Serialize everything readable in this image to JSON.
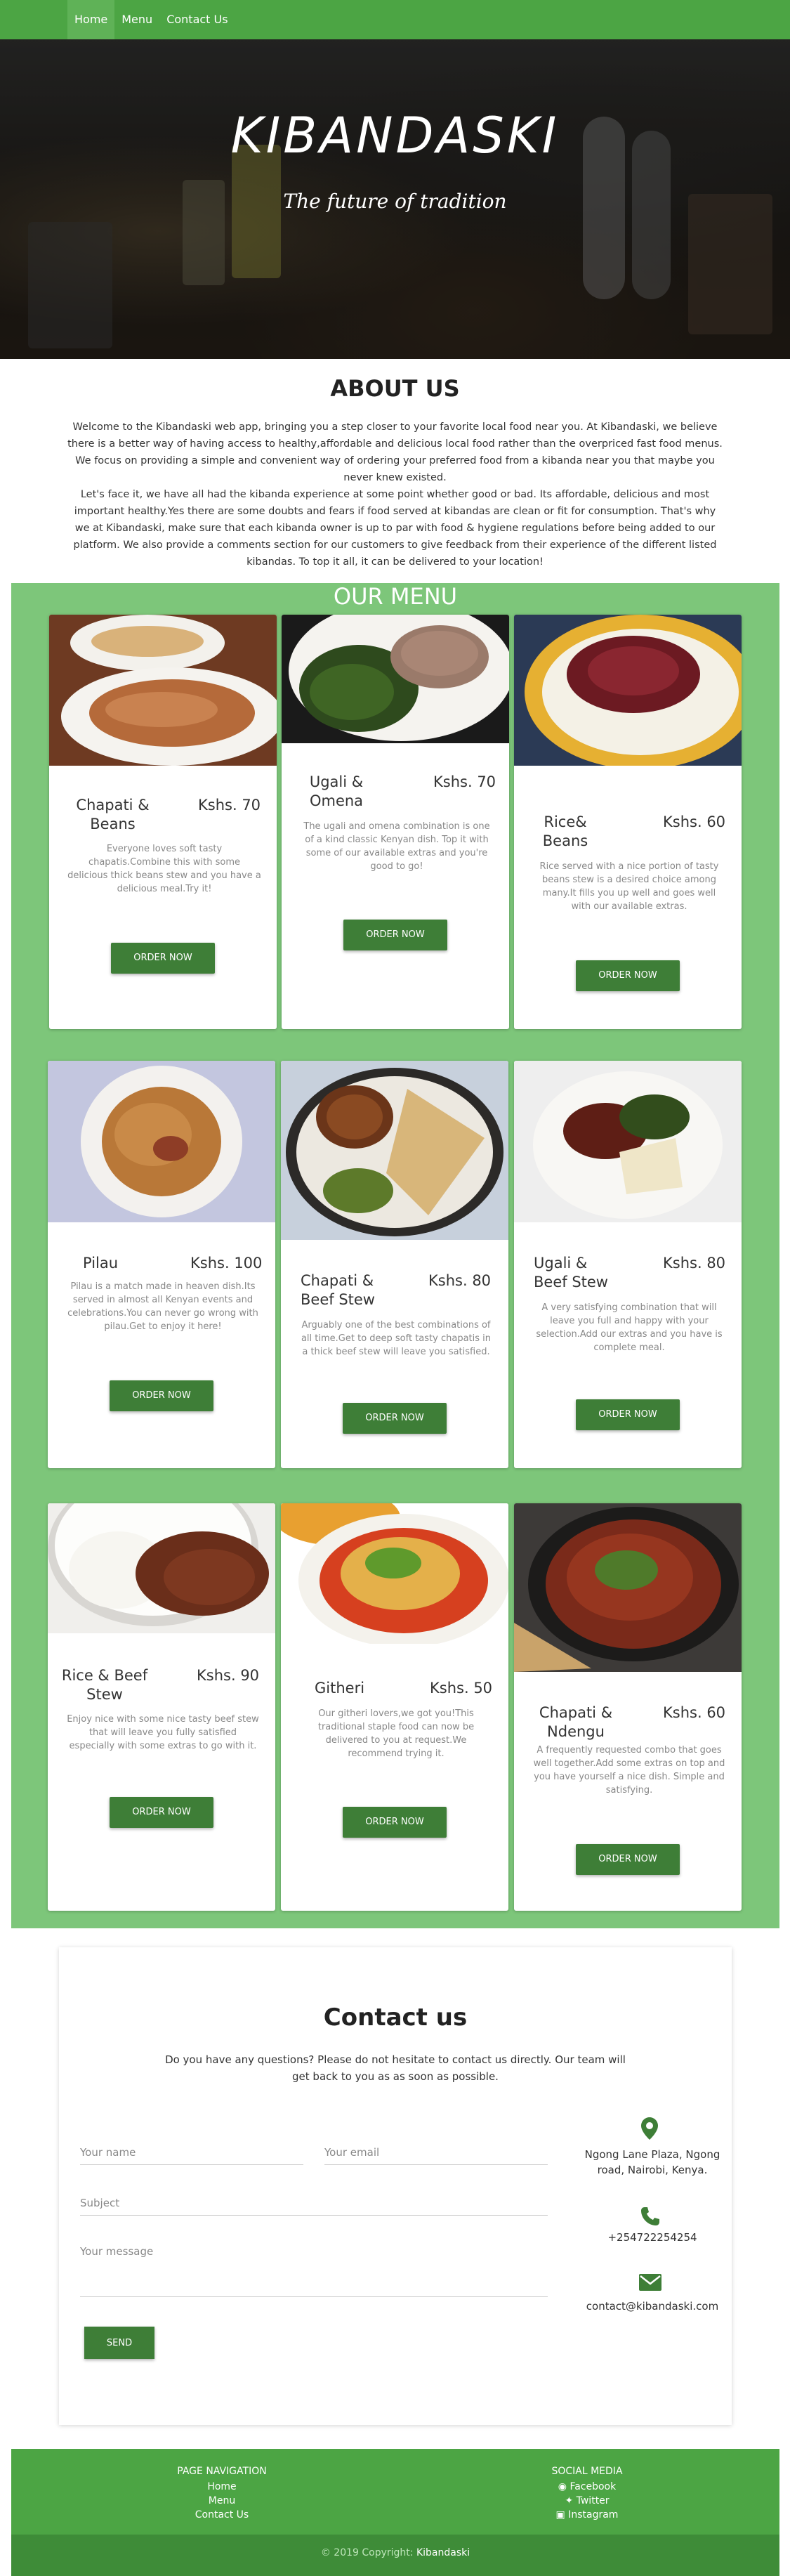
{
  "nav": {
    "items": [
      "Home",
      "Menu",
      "Contact Us"
    ]
  },
  "hero": {
    "title": "KIBANDASKI",
    "subtitle": "The future of tradition"
  },
  "about": {
    "title": "ABOUT US",
    "p1": "Welcome to the Kibandaski web app, bringing you a step closer to your favorite local food near you. At Kibandaski, we believe there is a better way of having access to healthy,affordable and delicious local food rather than the overpriced fast food menus. We focus on providing a simple and convenient way of ordering your preferred food from a kibanda near you that maybe you never knew existed.",
    "p2": "Let's face it, we have all had the kibanda experience at some point whether good or bad. Its affordable, delicious and most important healthy.Yes there are some doubts and fears if food served at kibandas are clean or fit for consumption. That's why we at Kibandaski, make sure that each kibanda owner is up to par with food & hygiene regulations before being added to our platform. We also provide a comments section for our customers to give feedback from their experience of the different listed kibandas. To top it all, it can be delivered to your location!"
  },
  "menu": {
    "title": "OUR MENU",
    "order_label": "ORDER NOW",
    "items": [
      {
        "name": "Chapati & Beans",
        "price": "Kshs. 70",
        "desc": "Everyone loves soft tasty chapatis.Combine this with some delicious thick beans stew and you have a delicious meal.Try it!",
        "image": "chapati-beans-photo"
      },
      {
        "name": "Ugali & Omena",
        "price": "Kshs. 70",
        "desc": "The ugali and omena combination is one of a kind classic Kenyan dish. Top it with some of our available extras and you're good to go!",
        "image": "ugali-omena-photo"
      },
      {
        "name": "Rice& Beans",
        "price": "Kshs. 60",
        "desc": "Rice served with a nice portion of tasty beans stew is a desired choice among many.It fills you up well and goes well with our available extras.",
        "image": "rice-beans-photo"
      },
      {
        "name": "Pilau",
        "price": "Kshs. 100",
        "desc": "Pilau is a match made in heaven dish.Its served in almost all Kenyan events and celebrations.You can never go wrong with pilau.Get to enjoy it here!",
        "image": "pilau-photo"
      },
      {
        "name": "Chapati & Beef Stew",
        "price": "Kshs. 80",
        "desc": "Arguably one of the best combinations of all time.Get to deep soft tasty chapatis in a thick beef stew will leave you satisfied.",
        "image": "chapati-beef-photo"
      },
      {
        "name": "Ugali & Beef Stew",
        "price": "Kshs. 80",
        "desc": "A very satisfying combination that will leave you full and happy with your selection.Add our extras and you have is complete meal.",
        "image": "ugali-beef-photo"
      },
      {
        "name": "Rice & Beef Stew",
        "price": "Kshs. 90",
        "desc": "Enjoy nice with some nice tasty beef stew that will leave you fully satisfied especially with some extras to go with it.",
        "image": "rice-beef-photo"
      },
      {
        "name": "Githeri",
        "price": "Kshs. 50",
        "desc": "Our githeri lovers,we got you!This traditional staple food can now be delivered to you at request.We recommend trying it.",
        "image": "githeri-photo"
      },
      {
        "name": "Chapati & Ndengu",
        "price": "Kshs. 60",
        "desc": "A frequently requested combo that goes well together.Add some extras on top and you have yourself a nice dish. Simple and satisfying.",
        "image": "chapati-ndengu-photo"
      }
    ]
  },
  "contact": {
    "title": "Contact us",
    "intro": "Do you have any questions? Please do not hesitate to contact us directly. Our team will get back to you as as soon as possible.",
    "name_placeholder": "Your name",
    "email_placeholder": "Your email",
    "subject_placeholder": "Subject",
    "message_placeholder": "Your message",
    "send_label": "SEND",
    "address": "Ngong Lane Plaza, Ngong road, Nairobi, Kenya.",
    "phone": "+254722254254",
    "email": "contact@kibandaski.com",
    "icons": [
      "map-marker-icon",
      "phone-icon",
      "envelope-icon"
    ]
  },
  "footer": {
    "nav_title": "PAGE NAVIGATION",
    "nav_links": [
      "Home",
      "Menu",
      "Contact Us"
    ],
    "social_title": "SOCIAL MEDIA",
    "social_links": [
      "Facebook",
      "Twitter",
      "Instagram"
    ],
    "copyright_prefix": "© 2019 Copyright:",
    "copyright_brand": "Kibandaski"
  },
  "colors": {
    "brand_green": "#4ca544",
    "menu_bg": "#7dc67a",
    "button_green": "#3e7e37"
  }
}
